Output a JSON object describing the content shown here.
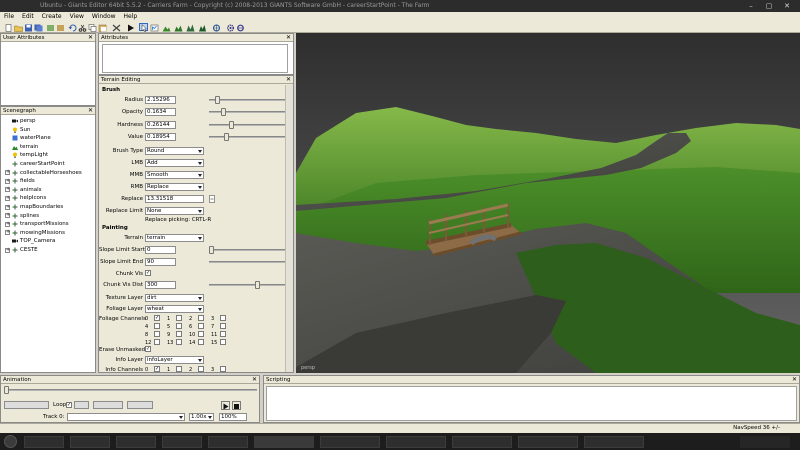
{
  "window": {
    "title": "Ubuntu - Giants Editor 64bit 5.5.2 - Carriers Farm - Copyright (c) 2008-2013 GIANTS Software GmbH - careerStartPoint - The Farm"
  },
  "menu": {
    "items": [
      "File",
      "Edit",
      "Create",
      "View",
      "Window",
      "Help"
    ]
  },
  "panels": {
    "user_attributes": "User Attributes",
    "attributes": "Attributes",
    "terrain_editing": "Terrain Editing",
    "scenegraph": "Scenegraph",
    "animation": "Animation",
    "scripting": "Scripting"
  },
  "scenegraph": {
    "items": [
      {
        "label": "persp",
        "icon": "camera-icon",
        "expandable": false
      },
      {
        "label": "Sun",
        "icon": "light-icon",
        "expandable": false
      },
      {
        "label": "waterPlane",
        "icon": "shape-icon",
        "expandable": false
      },
      {
        "label": "terrain",
        "icon": "terrain-icon",
        "expandable": false
      },
      {
        "label": "tempLight",
        "icon": "light-icon",
        "expandable": false
      },
      {
        "label": "careerStartPoint",
        "icon": "transform-icon",
        "expandable": false
      },
      {
        "label": "collectableHorseshoes",
        "icon": "transform-icon",
        "expandable": true
      },
      {
        "label": "fields",
        "icon": "transform-icon",
        "expandable": true
      },
      {
        "label": "animals",
        "icon": "transform-icon",
        "expandable": true
      },
      {
        "label": "helpIcons",
        "icon": "transform-icon",
        "expandable": true
      },
      {
        "label": "mapBoundaries",
        "icon": "transform-icon",
        "expandable": true
      },
      {
        "label": "splines",
        "icon": "transform-icon",
        "expandable": true
      },
      {
        "label": "transportMissions",
        "icon": "transform-icon",
        "expandable": true
      },
      {
        "label": "mowingMissions",
        "icon": "transform-icon",
        "expandable": true
      },
      {
        "label": "TOP_Camera",
        "icon": "camera-icon",
        "expandable": false
      },
      {
        "label": "CESTE",
        "icon": "transform-icon",
        "expandable": true
      }
    ]
  },
  "terrain": {
    "brush_label": "Brush",
    "radius_label": "Radius",
    "radius": "2.15296",
    "radius_level": 0.08,
    "opacity_label": "Opacity",
    "opacity": "0.1634",
    "opacity_level": 0.16,
    "hardness_label": "Hardness",
    "hardness": "0.26144",
    "hardness_level": 0.26,
    "value_label": "Value",
    "value": "0.18954",
    "value_level": 0.19,
    "brush_type_label": "Brush Type",
    "brush_type": "Round",
    "lmb_label": "LMB",
    "lmb": "Add",
    "mmb_label": "MMB",
    "mmb": "Smooth",
    "rmb_label": "RMB",
    "rmb": "Replace",
    "replace_label": "Replace",
    "replace": "13.31518",
    "replace_limit_label": "Replace Limit",
    "replace_limit": "None",
    "replace_hint": "Replace picking: CRTL-R",
    "painting_label": "Painting",
    "terrain_label": "Terrain",
    "terrain": "terrain",
    "slope_start_label": "Slope Limit Start",
    "slope_start": "0",
    "slope_start_level": 0.0,
    "slope_end_label": "Slope Limit End",
    "slope_end": "90",
    "slope_end_level": 1.0,
    "chunk_vis_label": "Chunk Vis",
    "chunk_vis": "✓",
    "chunk_vis_dist_label": "Chunk Vis Dist",
    "chunk_vis_dist": "300",
    "chunk_vis_dist_level": 0.6,
    "texture_layer_label": "Texture Layer",
    "texture_layer": "dirt",
    "foliage_layer_label": "Foliage Layer",
    "foliage_layer": "wheat",
    "foliage_channels_label": "Foliage Channels",
    "foliage_channels": [
      "0",
      "1",
      "2",
      "3",
      "4",
      "5",
      "6",
      "7",
      "8",
      "9",
      "10",
      "11",
      "12",
      "13",
      "14",
      "15"
    ],
    "foliage_checked": "✓",
    "erase_unmasked_label": "Erase Unmasked",
    "erase_unmasked": "✓",
    "info_layer_label": "Info Layer",
    "info_layer": "infoLayer",
    "info_channels_label": "Info Channels",
    "info_channels": [
      "0",
      "1",
      "2",
      "3"
    ],
    "info_checked": "✓"
  },
  "animation": {
    "loop_label": "Loop",
    "loop": "✓",
    "track_label": "Track 0:",
    "speed": "1.00x",
    "zoom": "100%"
  },
  "viewport": {
    "camera_label": "persp"
  },
  "status": {
    "nav_speed": "NavSpeed 36 +/-"
  },
  "colors": {
    "sky": "#4d4d4d",
    "grass": "#5a9a2e",
    "road": "#5d5d5d",
    "bridge": "#8a6a45"
  }
}
